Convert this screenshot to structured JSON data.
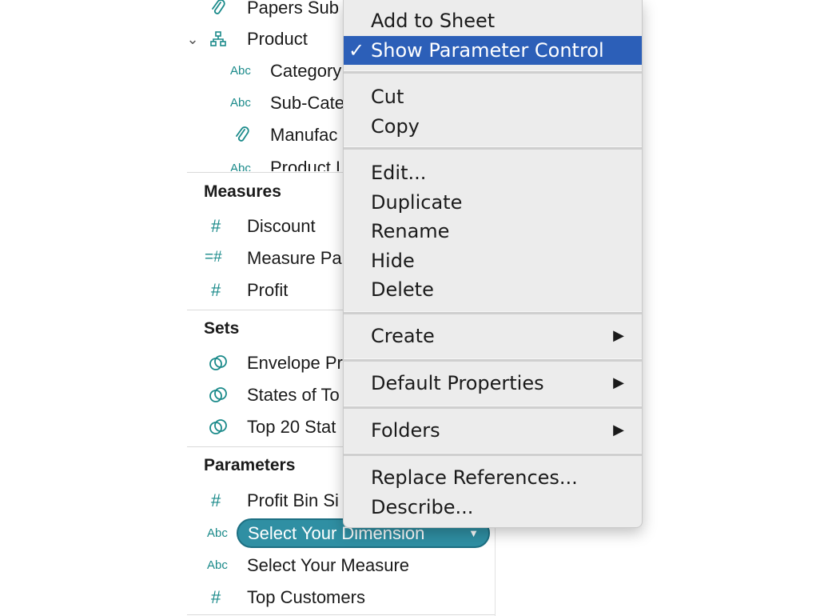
{
  "data_pane": {
    "dimension_rows": [
      {
        "icon": "paperclip-icon",
        "label": "Papers Sub"
      },
      {
        "icon": "hierarchy-icon",
        "label": "Product"
      },
      {
        "icon": "Abc",
        "label": "Category"
      },
      {
        "icon": "Abc",
        "label": "Sub-Cate"
      },
      {
        "icon": "paperclip-icon",
        "label": "Manufac"
      },
      {
        "icon": "Abc",
        "label": "Product I"
      }
    ],
    "measures": {
      "title": "Measures",
      "items": [
        {
          "icon": "#",
          "label": "Discount"
        },
        {
          "icon": "=#",
          "label": "Measure Pa"
        },
        {
          "icon": "#",
          "label": "Profit"
        }
      ]
    },
    "sets": {
      "title": "Sets",
      "items": [
        {
          "label": "Envelope Pr"
        },
        {
          "label": "States of To"
        },
        {
          "label": "Top 20 Stat"
        }
      ]
    },
    "parameters": {
      "title": "Parameters",
      "items": [
        {
          "icon": "#",
          "label": "Profit Bin Si"
        },
        {
          "icon": "Abc",
          "label": "Select Your Dimension",
          "selected": true
        },
        {
          "icon": "Abc",
          "label": "Select Your Measure"
        },
        {
          "icon": "#",
          "label": "Top Customers"
        }
      ]
    }
  },
  "context_menu": {
    "items": [
      {
        "label": "Add to Sheet"
      },
      {
        "label": "Show Parameter Control",
        "checked": true,
        "highlighted": true
      },
      {
        "label": "Cut"
      },
      {
        "label": "Copy"
      },
      {
        "label": "Edit..."
      },
      {
        "label": "Duplicate"
      },
      {
        "label": "Rename"
      },
      {
        "label": "Hide"
      },
      {
        "label": "Delete"
      },
      {
        "label": "Create",
        "submenu": true
      },
      {
        "label": "Default Properties",
        "submenu": true
      },
      {
        "label": "Folders",
        "submenu": true
      },
      {
        "label": "Replace References..."
      },
      {
        "label": "Describe..."
      }
    ],
    "check_glyph": "✓",
    "submenu_glyph": "▶"
  },
  "glyphs": {
    "number": "#",
    "calc_number": "=#",
    "abc": "Abc",
    "expand": "⌄",
    "pill_caret": "▼"
  },
  "colors": {
    "accent_teal": "#1a8a8a",
    "pill_fill": "#2f8fa3",
    "menu_highlight": "#2c5fb8",
    "menu_bg": "#ececec"
  }
}
